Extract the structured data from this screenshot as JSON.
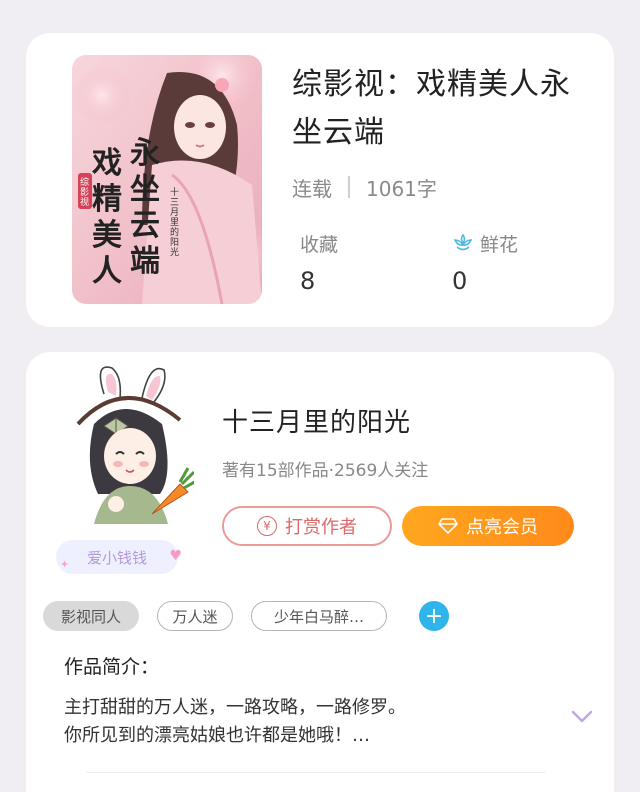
{
  "book": {
    "title": "综影视：戏精美人永坐云端",
    "status": "连载",
    "word_count": "1061字",
    "cover_title_lines": [
      "永坐云",
      "戏精美人端"
    ],
    "cover_tag": "综影视",
    "cover_author": "十三月里的阳光",
    "stats": {
      "favorites_label": "收藏",
      "favorites_value": "8",
      "flowers_label": "鲜花",
      "flowers_value": "0"
    }
  },
  "author": {
    "name": "十三月里的阳光",
    "meta": "著有15部作品·2569人关注",
    "fan_badge": "爱小钱钱",
    "reward_button": "打赏作者",
    "vip_button": "点亮会员"
  },
  "tags": [
    "影视同人",
    "万人迷",
    "少年白马醉…"
  ],
  "intro": {
    "heading": "作品简介：",
    "line1": "主打甜甜的万人迷，一路攻略，一路修罗。",
    "line2": "你所见到的漂亮姑娘也许都是她哦！…"
  },
  "colors": {
    "accent_orange": "#ff9a1f",
    "reward_red": "#d96a6a",
    "add_blue": "#2fb4ec",
    "badge_purple": "#b59bd9"
  },
  "icons": [
    "flower-icon",
    "yen-icon",
    "diamond-icon",
    "plus-icon",
    "chevron-down-icon"
  ]
}
